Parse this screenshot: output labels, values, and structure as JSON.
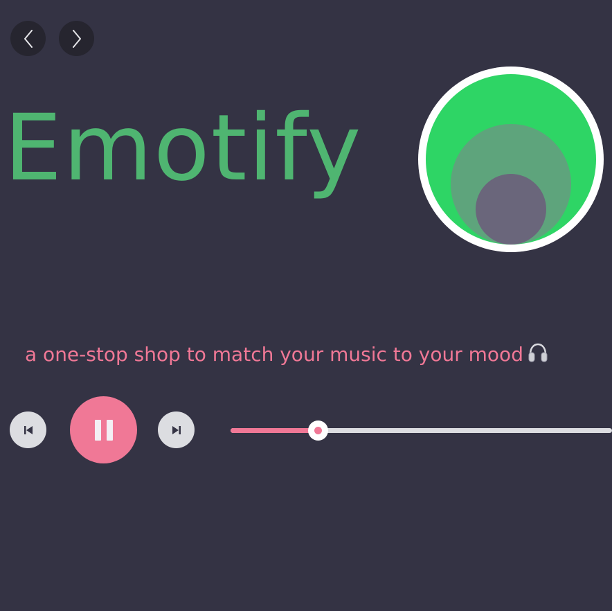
{
  "nav": {
    "back_icon": "chevron-left-icon",
    "forward_icon": "chevron-right-icon"
  },
  "hero": {
    "title": "Emotify",
    "logo_icon": "concentric-circles-logo",
    "tagline": "a one-stop shop to match your music to your mood",
    "tagline_icon": "headphones-icon"
  },
  "player": {
    "prev_icon": "skip-previous-icon",
    "play_pause_icon": "pause-icon",
    "next_icon": "skip-next-icon",
    "progress_fraction": 0.228
  },
  "colors": {
    "background": "#343344",
    "brand_green": "#4fb571",
    "accent_pink": "#f07896",
    "logo_green": "#2ed565",
    "logo_mid": "#5ea47c",
    "logo_inner": "#6a667b",
    "button_light": "#dcdde1",
    "nav_button": "#26252f"
  }
}
